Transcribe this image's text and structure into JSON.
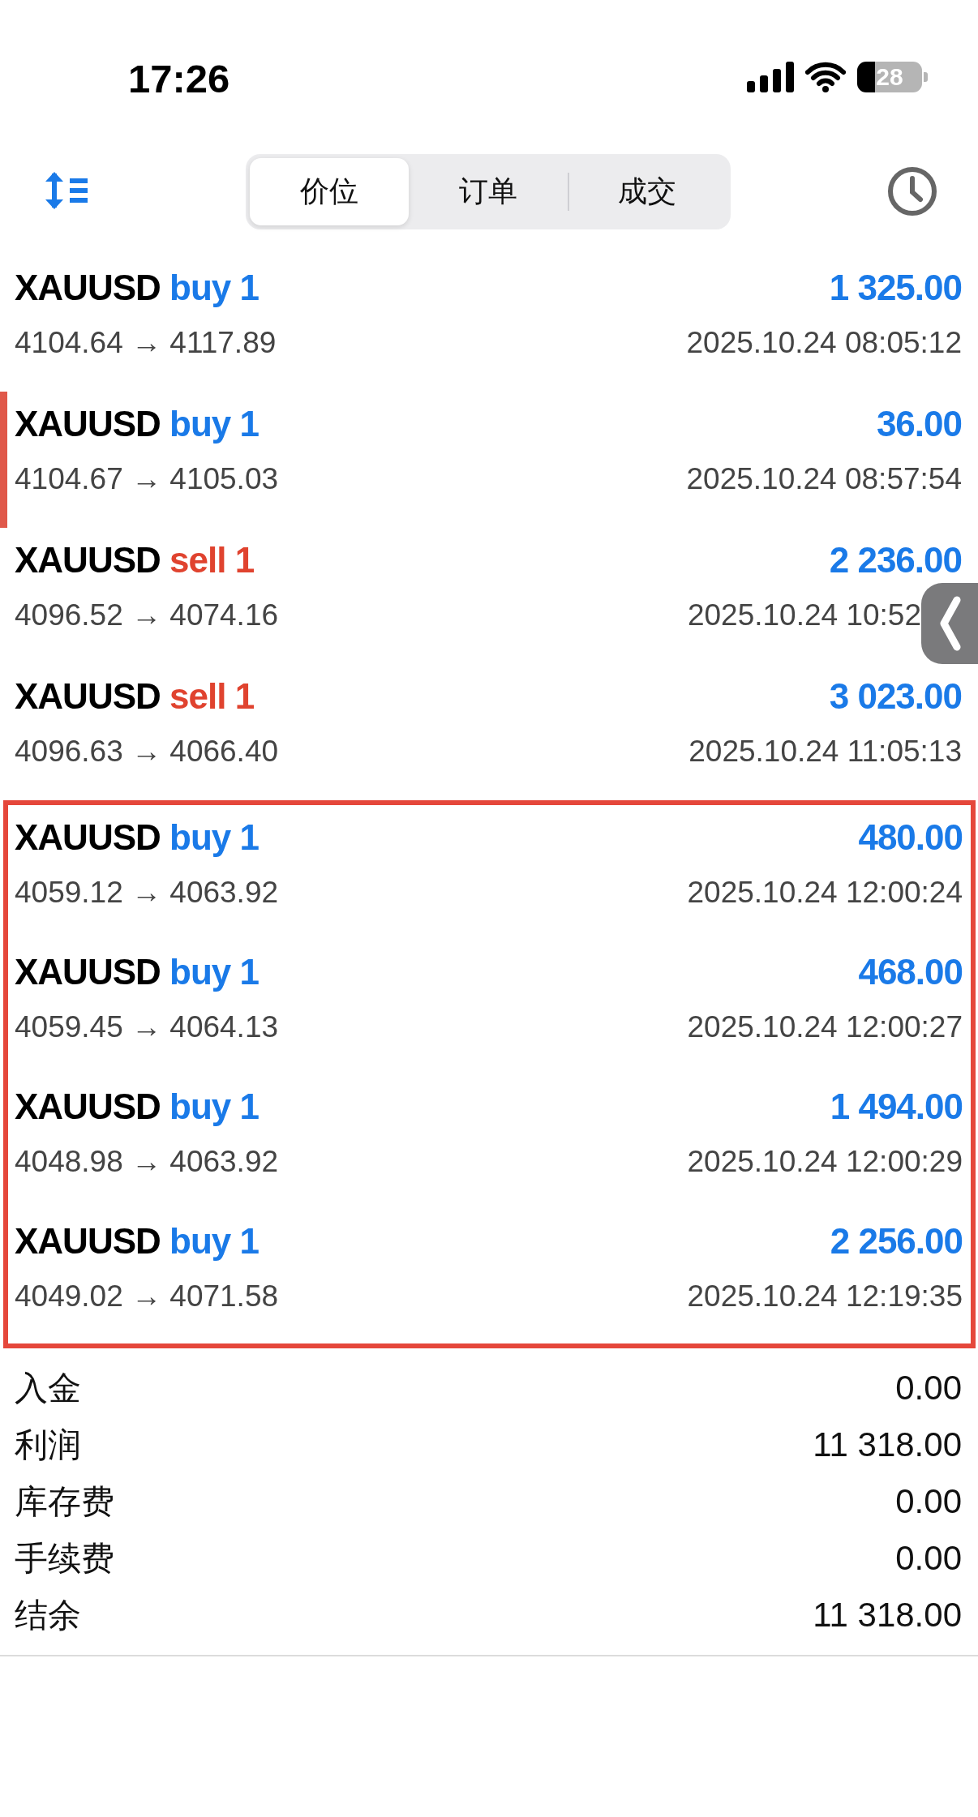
{
  "status_bar": {
    "time": "17:26",
    "battery": "28"
  },
  "tabs": [
    {
      "label": "价位",
      "selected": true
    },
    {
      "label": "订单",
      "selected": false
    },
    {
      "label": "成交",
      "selected": false
    }
  ],
  "trades": [
    {
      "symbol": "XAUUSD",
      "side": "buy",
      "volume": "1",
      "prices": "4104.64 → 4117.89",
      "profit": "1 325.00",
      "time": "2025.10.24 08:05:12",
      "marked": false,
      "highlighted": false,
      "side_handle": false
    },
    {
      "symbol": "XAUUSD",
      "side": "buy",
      "volume": "1",
      "prices": "4104.67 → 4105.03",
      "profit": "36.00",
      "time": "2025.10.24 08:57:54",
      "marked": true,
      "highlighted": false,
      "side_handle": false
    },
    {
      "symbol": "XAUUSD",
      "side": "sell",
      "volume": "1",
      "prices": "4096.52 → 4074.16",
      "profit": "2 236.00",
      "time": "2025.10.24 10:52",
      "marked": false,
      "highlighted": false,
      "side_handle": true
    },
    {
      "symbol": "XAUUSD",
      "side": "sell",
      "volume": "1",
      "prices": "4096.63 → 4066.40",
      "profit": "3 023.00",
      "time": "2025.10.24 11:05:13",
      "marked": false,
      "highlighted": false,
      "side_handle": false
    },
    {
      "symbol": "XAUUSD",
      "side": "buy",
      "volume": "1",
      "prices": "4059.12 → 4063.92",
      "profit": "480.00",
      "time": "2025.10.24 12:00:24",
      "marked": false,
      "highlighted": true,
      "side_handle": false
    },
    {
      "symbol": "XAUUSD",
      "side": "buy",
      "volume": "1",
      "prices": "4059.45 → 4064.13",
      "profit": "468.00",
      "time": "2025.10.24 12:00:27",
      "marked": false,
      "highlighted": true,
      "side_handle": false
    },
    {
      "symbol": "XAUUSD",
      "side": "buy",
      "volume": "1",
      "prices": "4048.98 → 4063.92",
      "profit": "1 494.00",
      "time": "2025.10.24 12:00:29",
      "marked": false,
      "highlighted": true,
      "side_handle": false
    },
    {
      "symbol": "XAUUSD",
      "side": "buy",
      "volume": "1",
      "prices": "4049.02 → 4071.58",
      "profit": "2 256.00",
      "time": "2025.10.24 12:19:35",
      "marked": false,
      "highlighted": true,
      "side_handle": false
    }
  ],
  "summary": [
    {
      "label": "入金",
      "value": "0.00"
    },
    {
      "label": "利润",
      "value": "11 318.00"
    },
    {
      "label": "库存费",
      "value": "0.00"
    },
    {
      "label": "手续费",
      "value": "0.00"
    },
    {
      "label": "结余",
      "value": "11 318.00"
    }
  ]
}
